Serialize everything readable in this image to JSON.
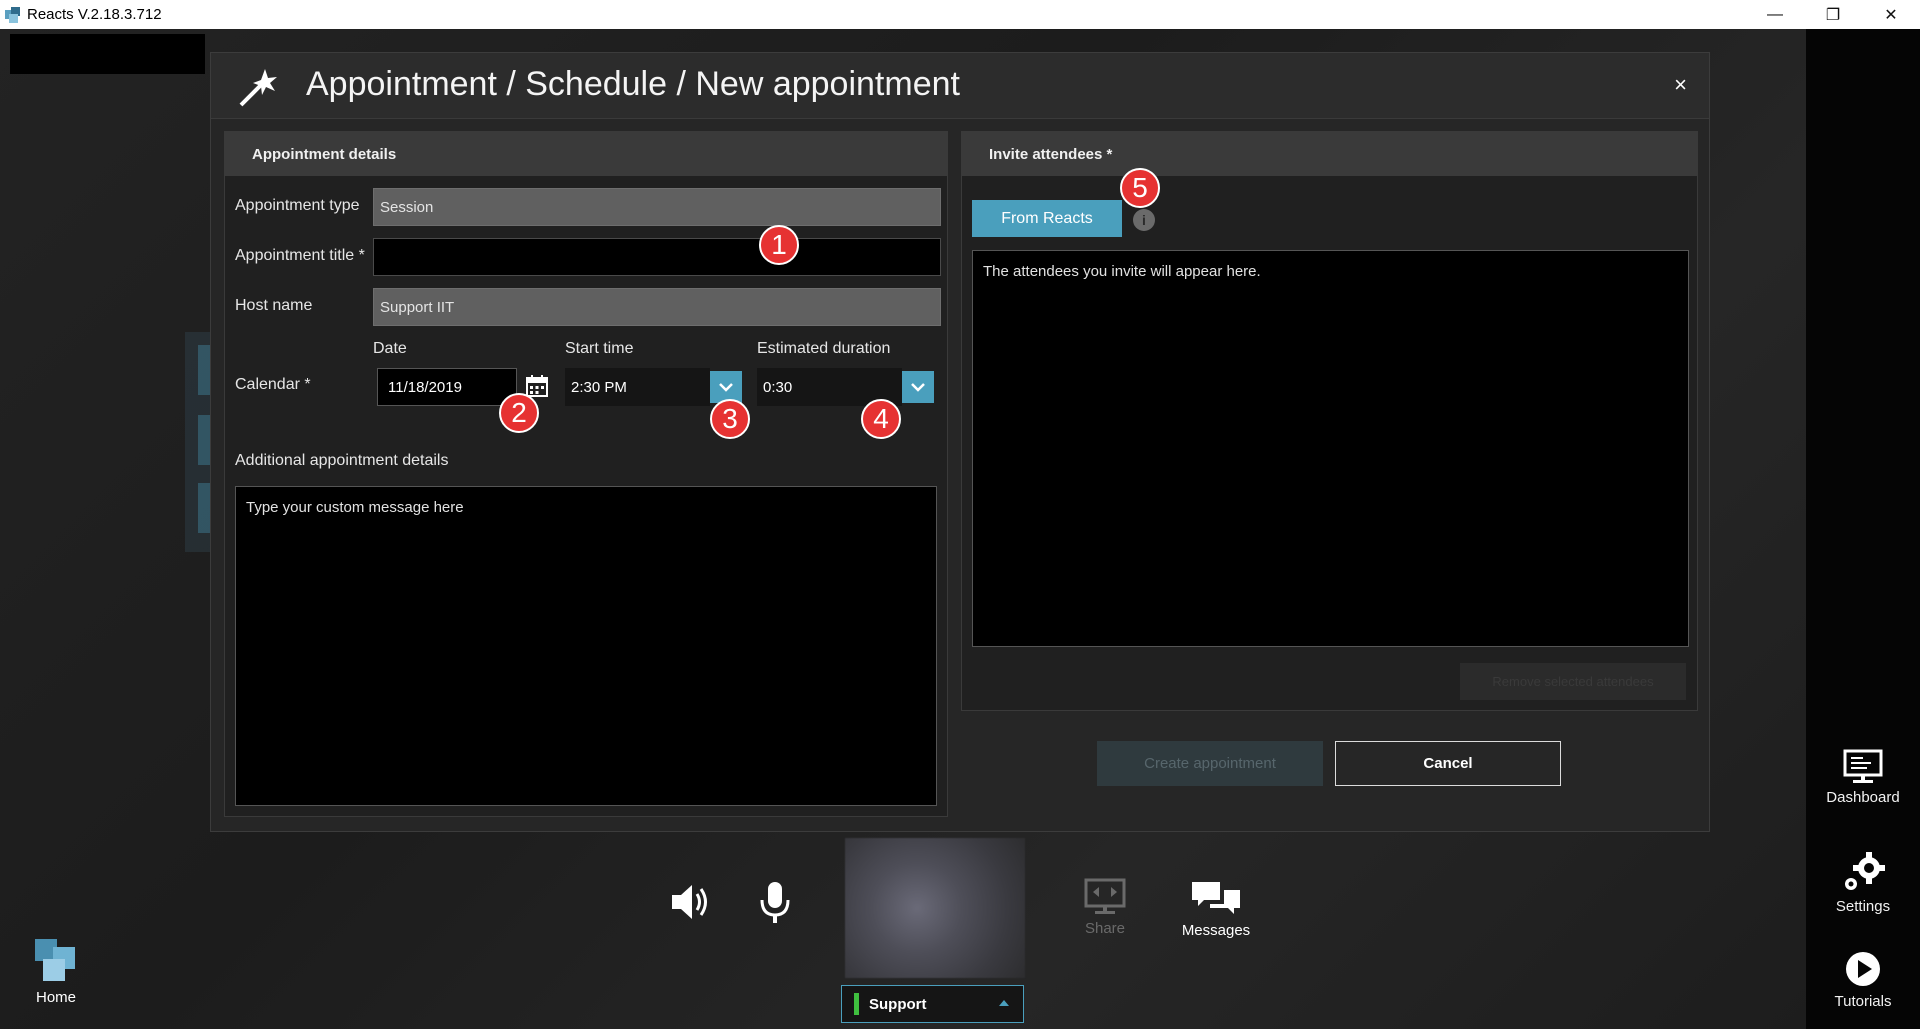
{
  "window": {
    "title": "Reacts V.2.18.3.712",
    "minimize": "—",
    "restore": "❐",
    "close": "✕"
  },
  "modal": {
    "title": "Appointment / Schedule / New appointment",
    "close": "×",
    "details_panel": {
      "heading": "Appointment details",
      "appointment_type_label": "Appointment type",
      "appointment_type_value": "Session",
      "appointment_title_label": "Appointment title *",
      "appointment_title_value": "",
      "host_name_label": "Host name",
      "host_name_value": "Support IIT",
      "calendar_label": "Calendar *",
      "date_label": "Date",
      "date_value": "11/18/2019",
      "start_time_label": "Start time",
      "start_time_value": "2:30 PM",
      "duration_label": "Estimated duration",
      "duration_value": "0:30",
      "additional_label": "Additional appointment details",
      "additional_placeholder": "Type your custom message here"
    },
    "invite_panel": {
      "heading": "Invite attendees *",
      "from_reacts_button": "From Reacts",
      "info_icon": "i",
      "empty_message": "The attendees you invite will appear here.",
      "hidden_button": "Remove selected attendees"
    },
    "create_button": "Create appointment",
    "cancel_button": "Cancel"
  },
  "badges": [
    "1",
    "2",
    "3",
    "4",
    "5"
  ],
  "bottom_bar": {
    "share_label": "Share",
    "messages_label": "Messages",
    "support_selector": "Support",
    "support_status_color": "#3fbf3f"
  },
  "right_rail": {
    "dashboard_label": "Dashboard",
    "settings_label": "Settings",
    "tutorials_label": "Tutorials"
  },
  "home_label": "Home",
  "colors": {
    "accent": "#4a9fbd",
    "badge": "#e63232"
  }
}
